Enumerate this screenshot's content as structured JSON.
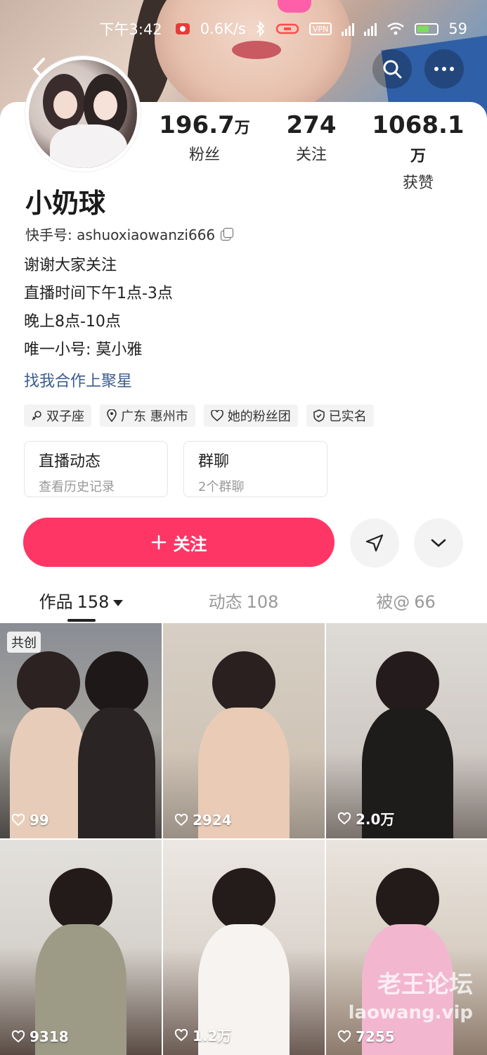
{
  "status_bar": {
    "time": "下午3:42",
    "speed": "0.6K/s",
    "vpn": "VPN",
    "battery": "59"
  },
  "profile": {
    "name": "小奶球",
    "kuaishou_id": "快手号: ashuoxiaowanzi666",
    "bio_lines": [
      "谢谢大家关注",
      "直播时间下午1点-3点",
      "晚上8点-10点",
      "唯一小号: 莫小雅"
    ],
    "coop_link": "找我合作上聚星"
  },
  "stats": [
    {
      "value": "196.7",
      "unit": "万",
      "label": "粉丝"
    },
    {
      "value": "274",
      "unit": "",
      "label": "关注"
    },
    {
      "value": "1068.1",
      "unit": "万",
      "label": "获赞"
    }
  ],
  "tags": [
    {
      "icon": "zodiac-icon",
      "label": "双子座"
    },
    {
      "icon": "location-icon",
      "label": "广东 惠州市"
    },
    {
      "icon": "heart-outline-icon",
      "label": "她的粉丝团"
    },
    {
      "icon": "shield-check-icon",
      "label": "已实名"
    }
  ],
  "boxes": [
    {
      "title": "直播动态",
      "sub": "查看历史记录"
    },
    {
      "title": "群聊",
      "sub": "2个群聊"
    }
  ],
  "follow": {
    "label": "关注",
    "accent": "#fe3666"
  },
  "tabs": [
    {
      "label": "作品",
      "count": "158"
    },
    {
      "label": "动态",
      "count": "108"
    },
    {
      "label": "被@",
      "count": "66"
    }
  ],
  "videos": [
    {
      "likes": "99",
      "badge": "共创"
    },
    {
      "likes": "2924"
    },
    {
      "likes": "2.0万"
    },
    {
      "likes": "9318"
    },
    {
      "likes": "1.2万"
    },
    {
      "likes": "7255"
    }
  ],
  "watermark": {
    "line1": "老王论坛",
    "line2": "laowang.vip"
  }
}
